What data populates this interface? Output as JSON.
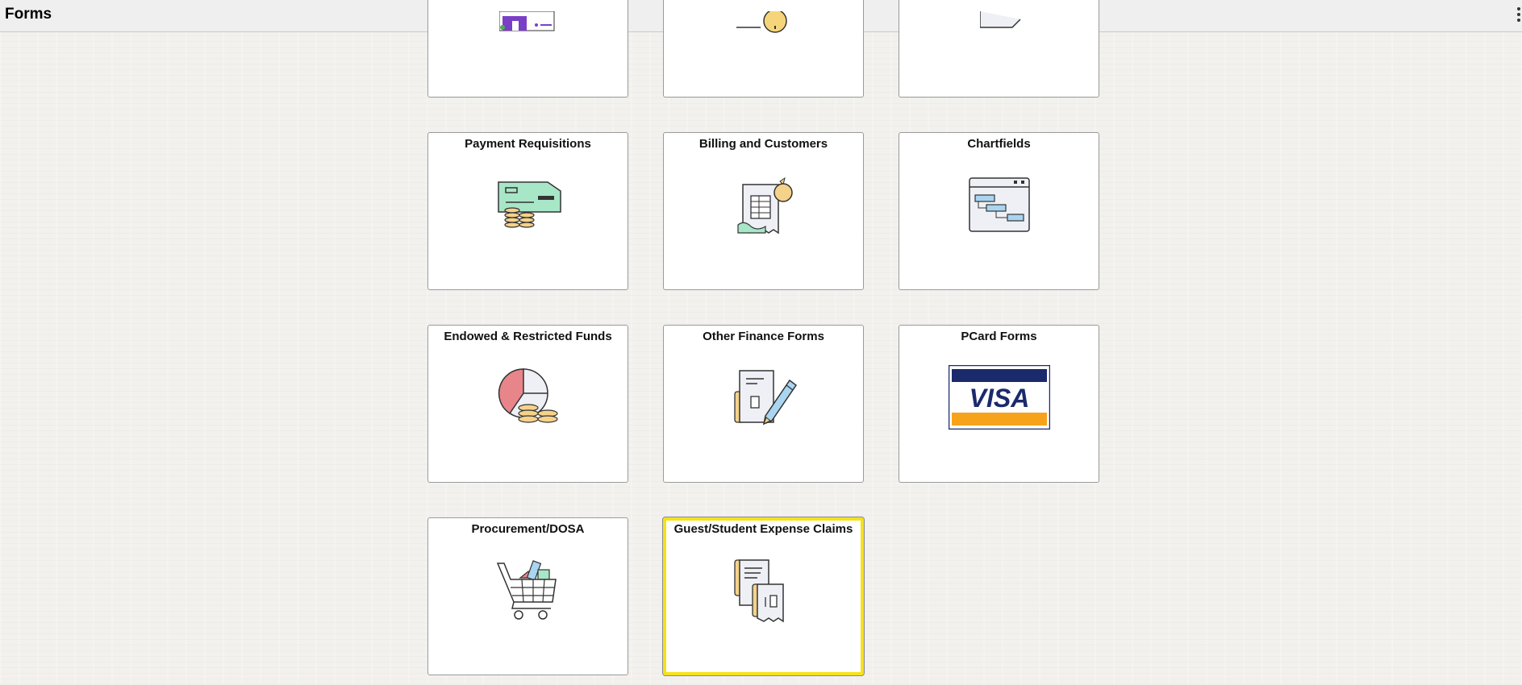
{
  "header": {
    "title": "Forms"
  },
  "tiles": [
    {
      "label": "",
      "icon": "partial-purple-form-icon"
    },
    {
      "label": "",
      "icon": "partial-coin-icon"
    },
    {
      "label": "",
      "icon": "partial-document-icon"
    },
    {
      "label": "Payment Requisitions",
      "icon": "check-and-coins-icon"
    },
    {
      "label": "Billing and Customers",
      "icon": "invoice-money-bag-icon"
    },
    {
      "label": "Chartfields",
      "icon": "gantt-window-icon"
    },
    {
      "label": "Endowed & Restricted Funds",
      "icon": "pie-chart-coins-icon"
    },
    {
      "label": "Other Finance Forms",
      "icon": "document-pencil-icon"
    },
    {
      "label": "PCard Forms",
      "icon": "visa-card-icon",
      "logo_text": "VISA"
    },
    {
      "label": "Procurement/DOSA",
      "icon": "shopping-cart-icon"
    },
    {
      "label": "Guest/Student Expense Claims",
      "icon": "receipts-icon",
      "selected": true
    }
  ],
  "colors": {
    "selected_border": "#f5e21a",
    "visa_blue": "#1a2a6c",
    "visa_gold": "#f7a21b"
  }
}
